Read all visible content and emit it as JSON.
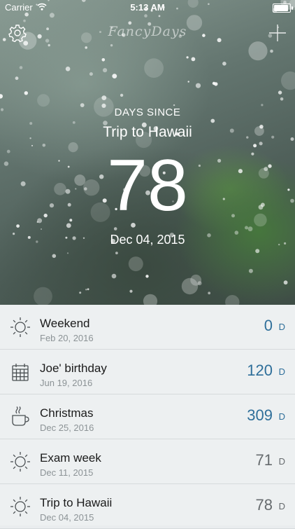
{
  "status_bar": {
    "carrier": "Carrier",
    "time": "5:13 AM"
  },
  "header": {
    "logo": "FancyDays",
    "settings_icon": "gear-icon",
    "add_icon": "plus-icon"
  },
  "featured": {
    "label": "DAYS SINCE",
    "title": "Trip to Hawaii",
    "count": "78",
    "date": "Dec 04, 2015"
  },
  "events": [
    {
      "name": "Weekend",
      "date": "Feb 20, 2016",
      "count": "0",
      "unit": "D",
      "icon": "sun-icon",
      "color": "#2f6f9a"
    },
    {
      "name": "Joe' birthday",
      "date": "Jun 19, 2016",
      "count": "120",
      "unit": "D",
      "icon": "calendar-icon",
      "color": "#2f6f9a"
    },
    {
      "name": "Christmas",
      "date": "Dec 25, 2016",
      "count": "309",
      "unit": "D",
      "icon": "coffee-cup-icon",
      "color": "#2f6f9a"
    },
    {
      "name": "Exam week",
      "date": "Dec 11, 2015",
      "count": "71",
      "unit": "D",
      "icon": "sun-icon",
      "color": "#666b6e"
    },
    {
      "name": "Trip to Hawaii",
      "date": "Dec 04, 2015",
      "count": "78",
      "unit": "D",
      "icon": "sun-icon",
      "color": "#666b6e"
    }
  ]
}
